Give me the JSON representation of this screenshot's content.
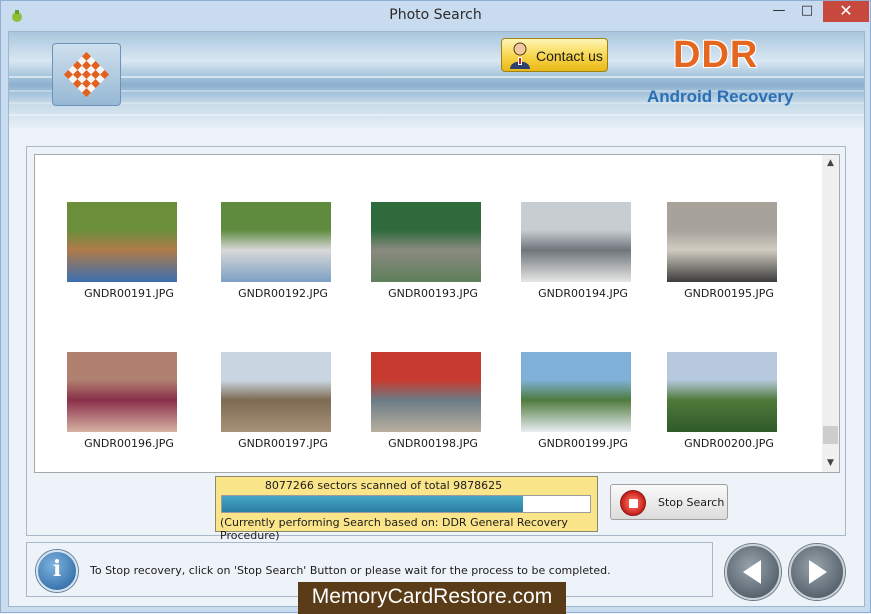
{
  "window": {
    "title": "Photo Search",
    "minimize_label": "—",
    "maximize_label": "□",
    "close_label": "✕"
  },
  "header": {
    "contact_label": "Contact us",
    "brand": "DDR",
    "brand_sub": "Android Recovery",
    "brand_color": "#e4661f",
    "sub_color": "#2a6fb6"
  },
  "gallery": {
    "items": [
      {
        "name": "GNDR00191.JPG",
        "colors": [
          "#6b8e3a",
          "#b07a4a",
          "#3a6fb0"
        ]
      },
      {
        "name": "GNDR00192.JPG",
        "colors": [
          "#5f8b3f",
          "#d8d8d8",
          "#7da0c4"
        ]
      },
      {
        "name": "GNDR00193.JPG",
        "colors": [
          "#2f6a3c",
          "#8a8a80",
          "#5e7f5a"
        ]
      },
      {
        "name": "GNDR00194.JPG",
        "colors": [
          "#c8cdd2",
          "#6f757a",
          "#e6e6e6"
        ]
      },
      {
        "name": "GNDR00195.JPG",
        "colors": [
          "#a7a39a",
          "#d0ccc2",
          "#3c3c3c"
        ]
      },
      {
        "name": "GNDR00196.JPG",
        "colors": [
          "#b08070",
          "#8a2f4a",
          "#d6b2a2"
        ]
      },
      {
        "name": "GNDR00197.JPG",
        "colors": [
          "#c9d6e2",
          "#7d6a52",
          "#a8927a"
        ]
      },
      {
        "name": "GNDR00198.JPG",
        "colors": [
          "#c73a2f",
          "#6b7b85",
          "#b9b0a0"
        ]
      },
      {
        "name": "GNDR00199.JPG",
        "colors": [
          "#7fb0d8",
          "#4f7a3f",
          "#e8eef2"
        ]
      },
      {
        "name": "GNDR00200.JPG",
        "colors": [
          "#b6c9de",
          "#4f7a3a",
          "#2f5a2a"
        ]
      }
    ]
  },
  "progress": {
    "status_text": "8077266 sectors scanned of total 9878625",
    "fraction": 0.8177,
    "procedure_text": "(Currently performing Search based on:  DDR General Recovery Procedure)"
  },
  "actions": {
    "stop_label": "Stop Search"
  },
  "info": {
    "icon_text": "i",
    "message": "To Stop recovery, click on 'Stop Search' Button or please wait for the process to be completed."
  },
  "watermark": "MemoryCardRestore.com"
}
